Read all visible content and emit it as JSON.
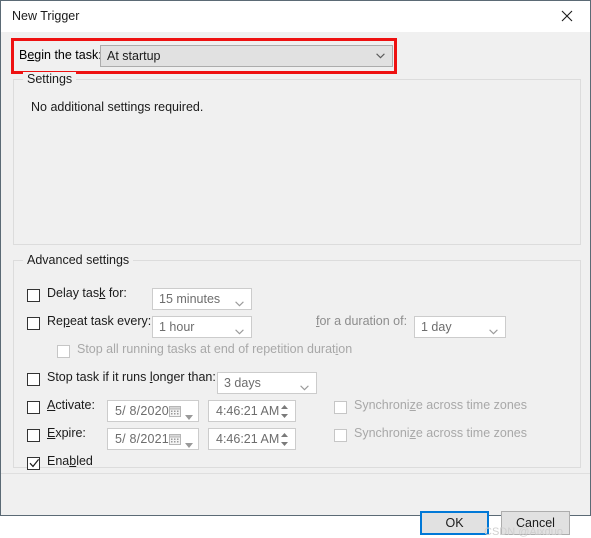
{
  "window": {
    "title": "New Trigger",
    "close_icon": "close-icon"
  },
  "begin": {
    "label_pre": "B",
    "label_accel": "e",
    "label_post": "gin the task:",
    "label_full": "Begin the task:",
    "value": "At startup",
    "highlight_color": "#ee1111"
  },
  "settings": {
    "group_title": "Settings",
    "text": "No additional settings required."
  },
  "advanced": {
    "group_title": "Advanced settings",
    "delay": {
      "label": "Delay task for:",
      "checked": false,
      "value": "15 minutes"
    },
    "repeat": {
      "label": "Repeat task every:",
      "checked": false,
      "value": "1 hour",
      "duration_label": "for a duration of:",
      "duration_value": "1 day"
    },
    "stop_repetition": {
      "label": "Stop all running tasks at end of repetition duration",
      "checked": false,
      "disabled": true
    },
    "stop_longer": {
      "label": "Stop task if it runs longer than:",
      "checked": false,
      "value": "3 days"
    },
    "activate": {
      "label": "Activate:",
      "checked": false,
      "date": "5/  8/2020",
      "time": "4:46:21 AM",
      "sync_label": "Synchronize across time zones",
      "sync_checked": false
    },
    "expire": {
      "label": "Expire:",
      "checked": false,
      "date": "5/  8/2021",
      "time": "4:46:21 AM",
      "sync_label": "Synchronize across time zones",
      "sync_checked": false
    },
    "enabled": {
      "label": "Enabled",
      "checked": true
    }
  },
  "footer": {
    "ok": "OK",
    "cancel": "Cancel"
  },
  "watermark": "CSDN @Aixduo"
}
